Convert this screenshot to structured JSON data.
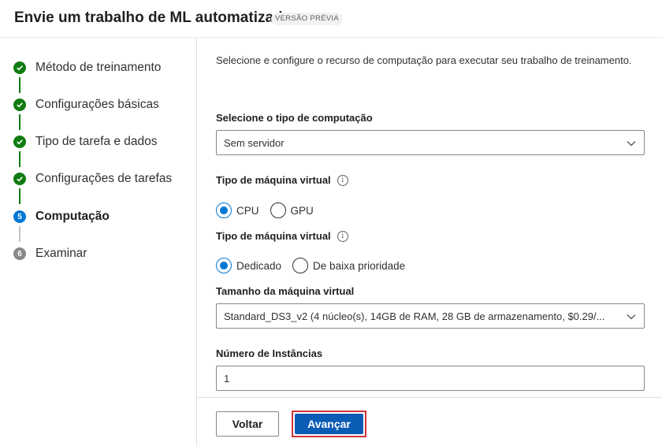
{
  "header": {
    "title": "Envie um trabalho de ML automatizado",
    "badge": "VERSÃO PRÉVIA"
  },
  "steps": [
    {
      "label": "Método de treinamento",
      "state": "done"
    },
    {
      "label": "Configurações básicas",
      "state": "done"
    },
    {
      "label": "Tipo de tarefa e dados",
      "state": "done"
    },
    {
      "label": "Configurações de tarefas",
      "state": "done"
    },
    {
      "label": "Computação",
      "state": "active",
      "number": "5"
    },
    {
      "label": "Examinar",
      "state": "todo",
      "number": "6"
    }
  ],
  "form": {
    "description": "Selecione e configure o recurso de computação para executar seu trabalho de treinamento.",
    "compute_type": {
      "label": "Selecione o tipo de computação",
      "value": "Sem servidor"
    },
    "vm_type": {
      "label": "Tipo de máquina virtual",
      "options": [
        "CPU",
        "GPU"
      ],
      "selected": "CPU"
    },
    "vm_tier": {
      "label": "Tipo de máquina virtual",
      "options": [
        "Dedicado",
        "De baixa prioridade"
      ],
      "selected": "Dedicado"
    },
    "vm_size": {
      "label": "Tamanho da máquina virtual",
      "value": "Standard_DS3_v2 (4 núcleo(s), 14GB de RAM, 28 GB de armazenamento, $0.29/..."
    },
    "instances": {
      "label": "Número de Instâncias",
      "value": "1"
    }
  },
  "footer": {
    "back_label": "Voltar",
    "next_label": "Avançar"
  },
  "colors": {
    "done": "#107c10",
    "active": "#0078d4",
    "primary_button": "#0b5cb5",
    "highlight_border": "#d13438"
  }
}
